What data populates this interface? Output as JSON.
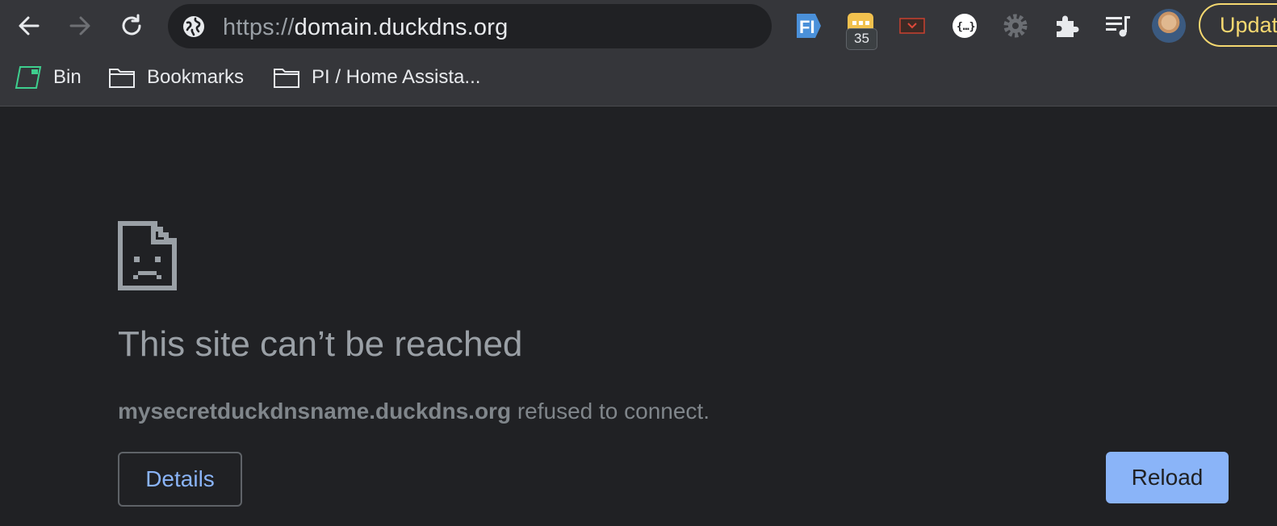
{
  "toolbar": {
    "back_icon": "arrow-left-icon",
    "forward_icon": "arrow-right-icon",
    "reload_icon": "reload-icon",
    "url_scheme": "https://",
    "url_host": "domain.duckdns.org",
    "site_info_icon": "globe-icon",
    "extensions": [
      {
        "name": "fi-extension-icon",
        "color": "#4a90d9"
      },
      {
        "name": "yellow-extension-icon",
        "color": "#f2c14e",
        "badge": "35"
      },
      {
        "name": "pocket-extension-icon",
        "color": "#c9402f"
      },
      {
        "name": "json-extension-icon",
        "color": "#ffffff"
      },
      {
        "name": "gear-extension-icon",
        "color": "#6b6e73"
      },
      {
        "name": "puzzle-icon",
        "color": "#e8eaed"
      },
      {
        "name": "media-queue-icon",
        "color": "#e8eaed"
      }
    ],
    "avatar": "profile-avatar",
    "update_label": "Update"
  },
  "bookmarks": [
    {
      "label": "Bin",
      "icon": "bin-icon"
    },
    {
      "label": "Bookmarks",
      "icon": "folder-icon"
    },
    {
      "label": "PI / Home Assista...",
      "icon": "folder-icon"
    }
  ],
  "error": {
    "icon": "sad-page-icon",
    "title": "This site can’t be reached",
    "host": "mysecretduckdnsname.duckdns.org",
    "message_suffix": " refused to connect.",
    "details_label": "Details",
    "reload_label": "Reload"
  },
  "colors": {
    "background": "#202124",
    "toolbar": "#35363a",
    "accent": "#8ab4f8",
    "update": "#f5d870"
  }
}
